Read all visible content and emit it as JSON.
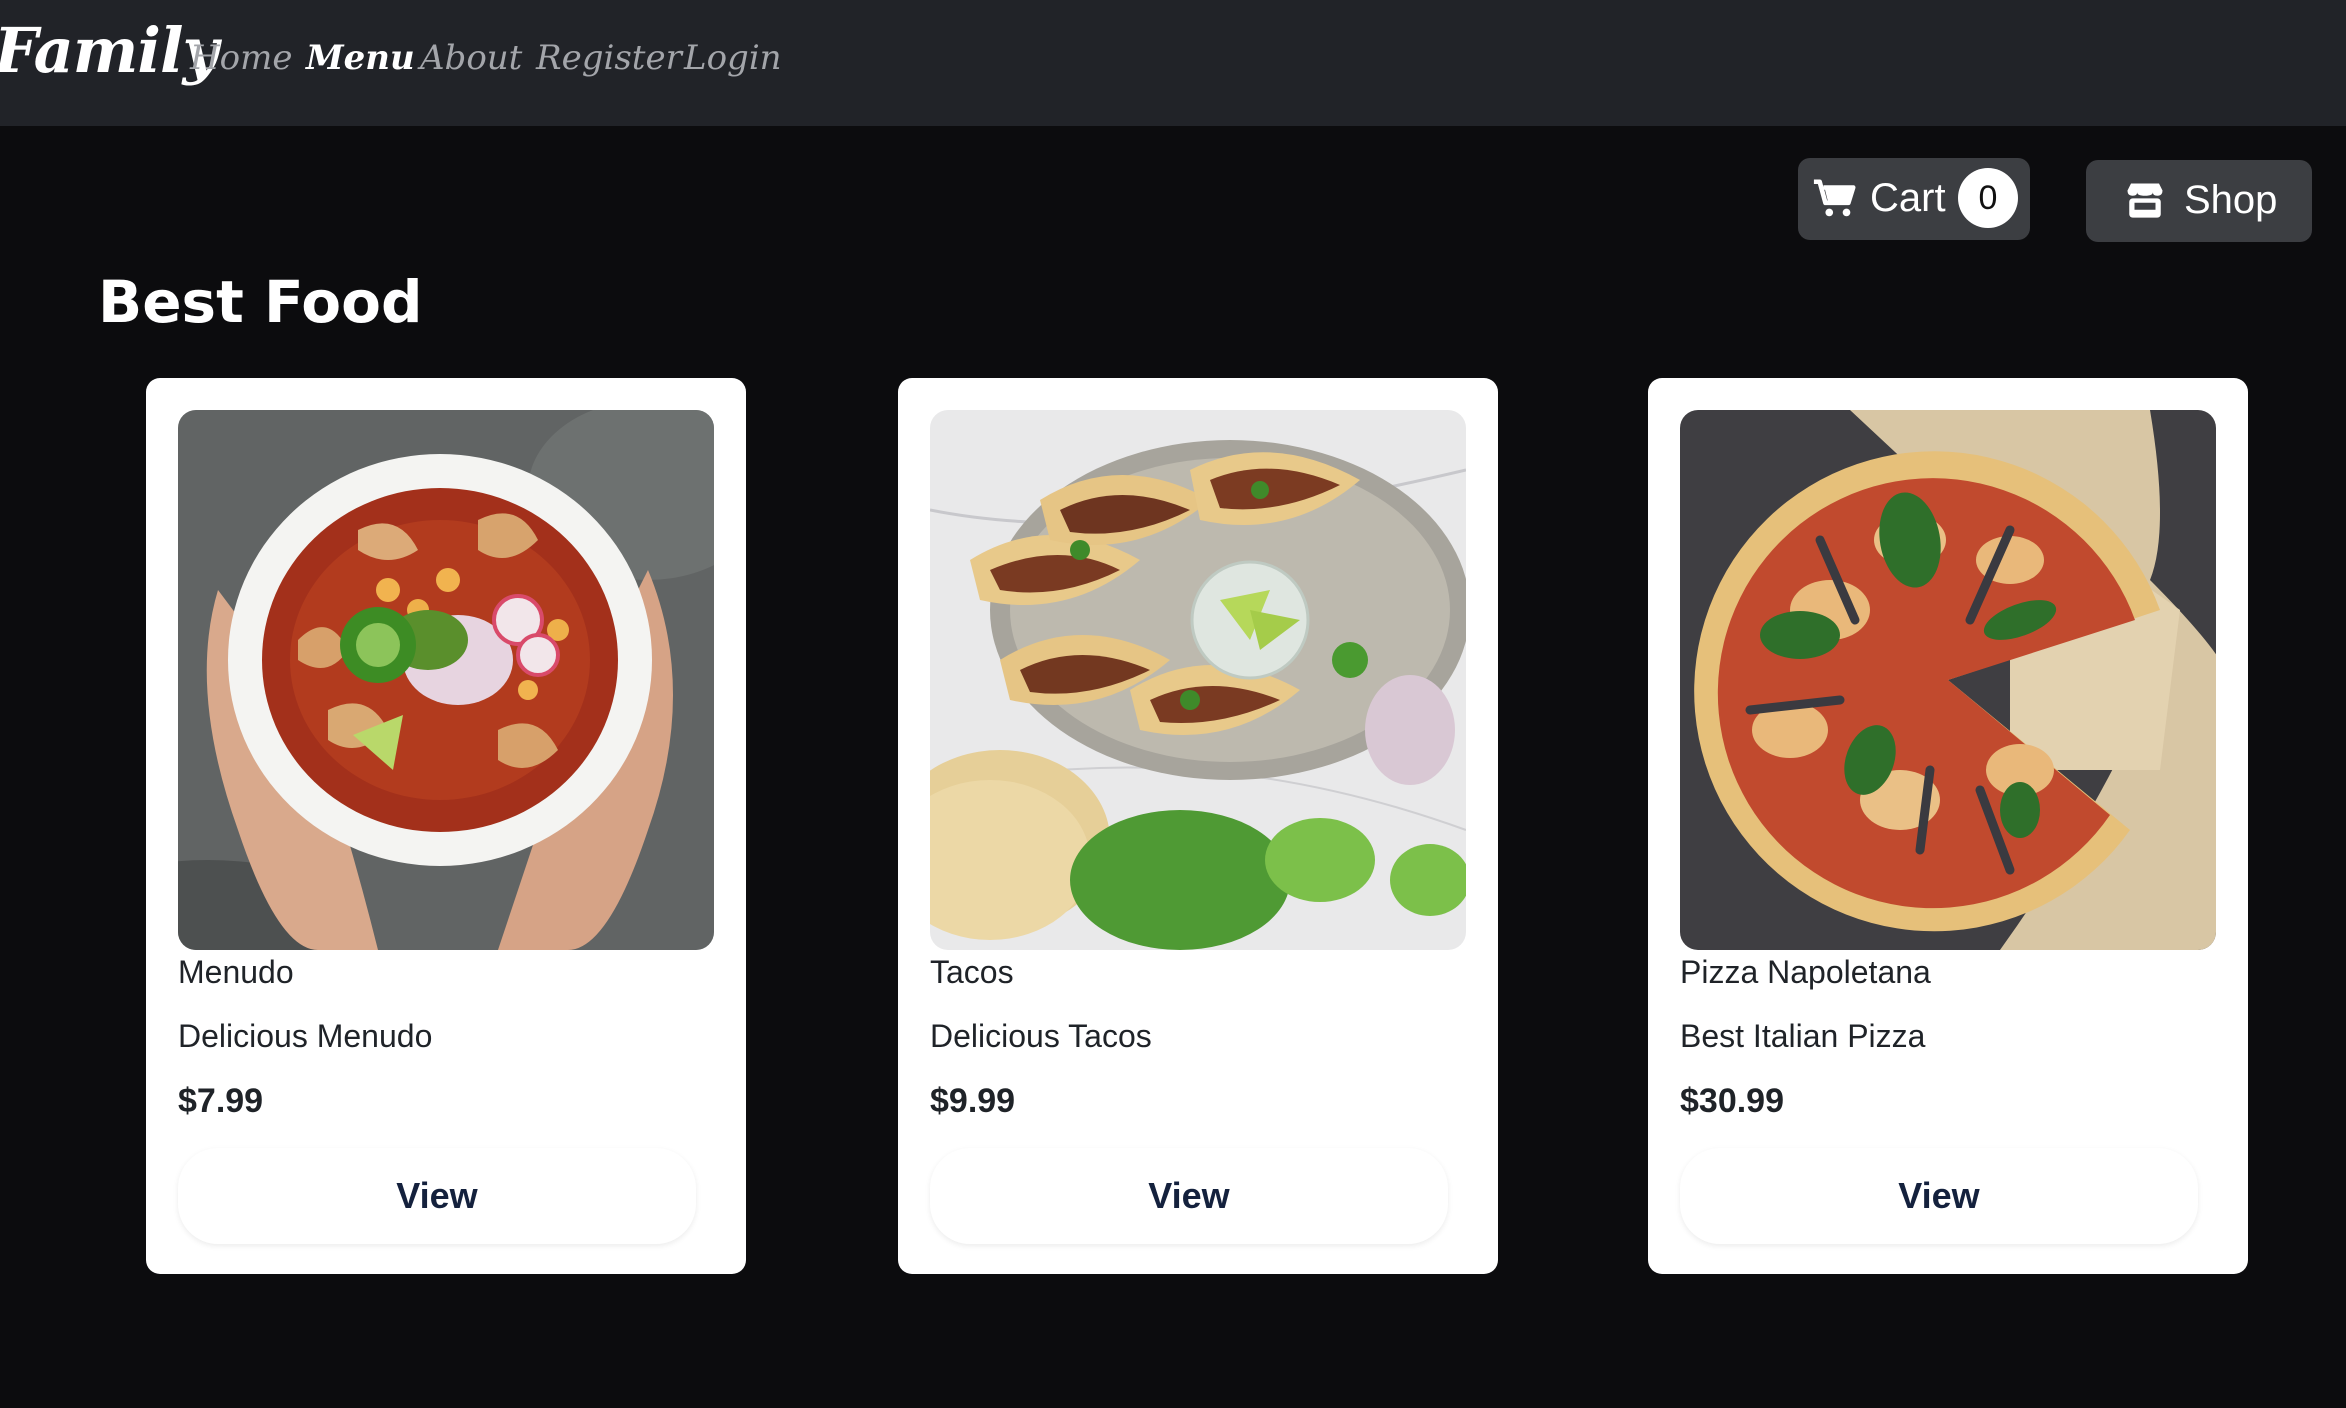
{
  "navbar": {
    "brand": "Family",
    "links": [
      {
        "label": "Home",
        "active": false
      },
      {
        "label": "Menu",
        "active": true
      },
      {
        "label": "About",
        "active": false
      },
      {
        "label": "Register",
        "active": false
      },
      {
        "label": "Login",
        "active": false
      }
    ]
  },
  "cart": {
    "label": "Cart",
    "count": "0",
    "icon": "cart-icon"
  },
  "shop": {
    "label": "Shop",
    "icon": "store-icon"
  },
  "section": {
    "title": "Best Food"
  },
  "products": [
    {
      "name": "Menudo",
      "description": "Delicious Menudo",
      "price": "$7.99",
      "button": "View",
      "image": "menudo-photo"
    },
    {
      "name": "Tacos",
      "description": "Delicious Tacos",
      "price": "$9.99",
      "button": "View",
      "image": "tacos-photo"
    },
    {
      "name": "Pizza Napoletana",
      "description": "Best Italian Pizza",
      "price": "$30.99",
      "button": "View",
      "image": "pizza-photo"
    }
  ],
  "colors": {
    "background": "#0c0c0e",
    "navbar": "#212328",
    "button": "#3c3e42",
    "card": "#ffffff"
  }
}
